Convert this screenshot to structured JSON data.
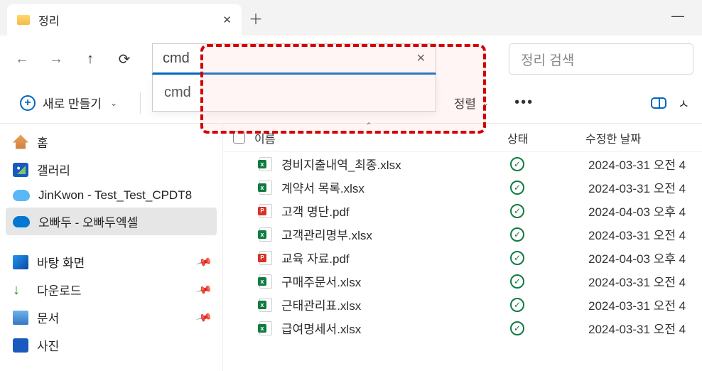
{
  "tab": {
    "title": "정리"
  },
  "address": {
    "value": "cmd",
    "suggestion": "cmd"
  },
  "search": {
    "placeholder": "정리 검색"
  },
  "toolbar": {
    "new": "새로 만들기",
    "sort": "정렬"
  },
  "sidebar": {
    "home": "홈",
    "gallery": "갤러리",
    "od1": "JinKwon - Test_Test_CPDT8",
    "od2": "오빠두 - 오빠두엑셀",
    "desktop": "바탕 화면",
    "downloads": "다운로드",
    "docs": "문서",
    "pics": "사진"
  },
  "columns": {
    "name": "이름",
    "status": "상태",
    "date": "수정한 날짜"
  },
  "files": [
    {
      "name": "경비지출내역_최종.xlsx",
      "type": "xlsx",
      "date": "2024-03-31 오전 4"
    },
    {
      "name": "계약서 목록.xlsx",
      "type": "xlsx",
      "date": "2024-03-31 오전 4"
    },
    {
      "name": "고객 명단.pdf",
      "type": "pdf",
      "date": "2024-04-03 오후 4"
    },
    {
      "name": "고객관리명부.xlsx",
      "type": "xlsx",
      "date": "2024-03-31 오전 4"
    },
    {
      "name": "교육 자료.pdf",
      "type": "pdf",
      "date": "2024-04-03 오후 4"
    },
    {
      "name": "구매주문서.xlsx",
      "type": "xlsx",
      "date": "2024-03-31 오전 4"
    },
    {
      "name": "근태관리표.xlsx",
      "type": "xlsx",
      "date": "2024-03-31 오전 4"
    },
    {
      "name": "급여명세서.xlsx",
      "type": "xlsx",
      "date": "2024-03-31 오전 4"
    }
  ]
}
